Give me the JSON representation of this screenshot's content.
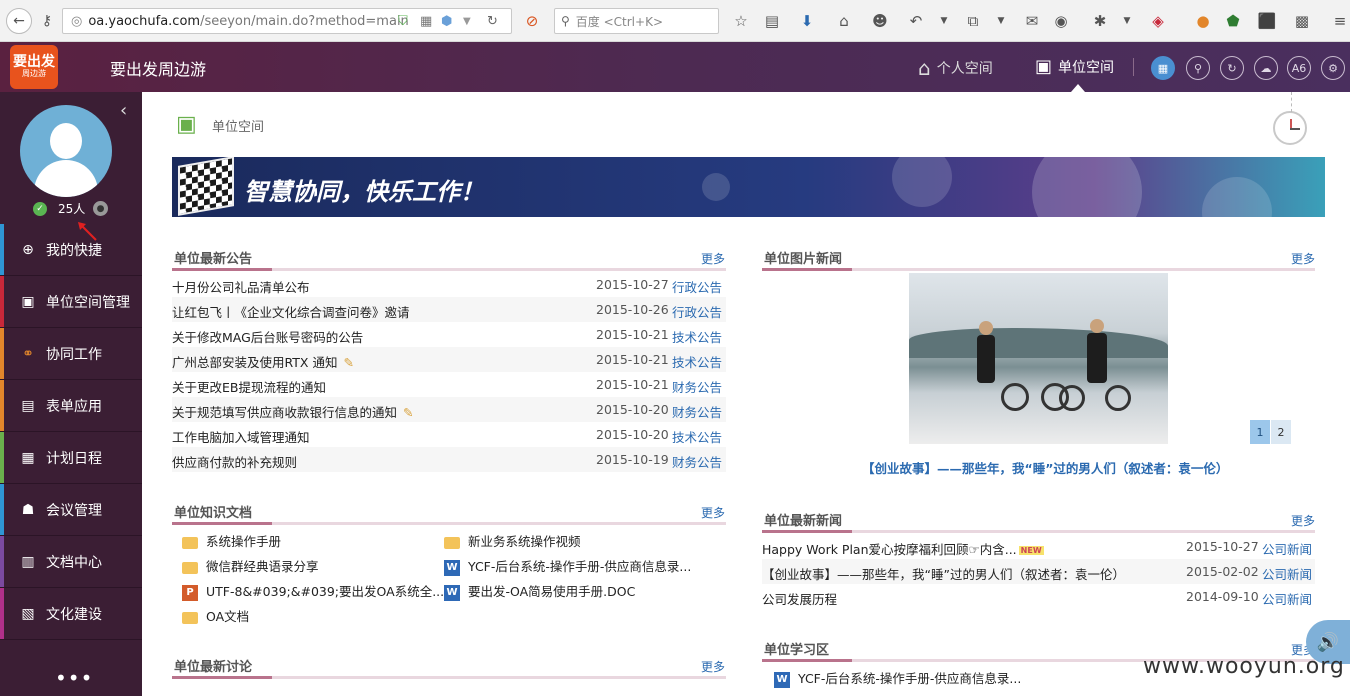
{
  "browser": {
    "url_domain": "oa.yaochufa.com",
    "url_path": "/seeyon/main.do?method=main",
    "search_placeholder": "百度 <Ctrl+K>"
  },
  "header": {
    "logo_main": "要出发",
    "logo_sub": "周边游",
    "app_title": "要出发周边游",
    "tabs": [
      {
        "label": "个人空间",
        "icon": "home-icon"
      },
      {
        "label": "单位空间",
        "icon": "building-icon"
      }
    ],
    "tool_icons": [
      "grid-icon",
      "search-icon",
      "refresh-icon",
      "cloud-icon",
      "a6-icon",
      "settings-icon"
    ],
    "a6_label": "A6"
  },
  "sidebar": {
    "online_count": "25人",
    "menu": [
      {
        "label": "我的快捷",
        "icon": "plus-circle-icon",
        "color": "#2f96d4"
      },
      {
        "label": "单位空间管理",
        "icon": "building-icon",
        "color": "#c8283a"
      },
      {
        "label": "协同工作",
        "icon": "share-icon",
        "color": "#e2862b"
      },
      {
        "label": "表单应用",
        "icon": "form-icon",
        "color": "#e2862b"
      },
      {
        "label": "计划日程",
        "icon": "calendar-icon",
        "color": "#6ab04c"
      },
      {
        "label": "会议管理",
        "icon": "meeting-icon",
        "color": "#2f96d4"
      },
      {
        "label": "文档中心",
        "icon": "document-icon",
        "color": "#7b4aa0"
      },
      {
        "label": "文化建设",
        "icon": "culture-icon",
        "color": "#b0308a"
      }
    ],
    "more": "•••"
  },
  "main": {
    "breadcrumb": "单位空间",
    "banner_text": "智慧协同，快乐工作！",
    "more_label": "更多",
    "announcements": {
      "title": "单位最新公告",
      "items": [
        {
          "title": "十月份公司礼品清单公布",
          "date": "2015-10-27",
          "category": "行政公告",
          "attach": false
        },
        {
          "title": "让红包飞丨《企业文化综合调查问卷》邀请",
          "date": "2015-10-26",
          "category": "行政公告",
          "attach": false
        },
        {
          "title": "关于修改MAG后台账号密码的公告",
          "date": "2015-10-21",
          "category": "技术公告",
          "attach": false
        },
        {
          "title": "广州总部安装及使用RTX 通知",
          "date": "2015-10-21",
          "category": "技术公告",
          "attach": true
        },
        {
          "title": "关于更改EB提现流程的通知",
          "date": "2015-10-21",
          "category": "财务公告",
          "attach": false
        },
        {
          "title": "关于规范填写供应商收款银行信息的通知",
          "date": "2015-10-20",
          "category": "财务公告",
          "attach": true
        },
        {
          "title": "工作电脑加入域管理通知",
          "date": "2015-10-20",
          "category": "技术公告",
          "attach": false
        },
        {
          "title": "供应商付款的补充规则",
          "date": "2015-10-19",
          "category": "财务公告",
          "attach": false
        }
      ]
    },
    "knowledge": {
      "title": "单位知识文档",
      "items": [
        {
          "name": "系统操作手册",
          "type": "folder"
        },
        {
          "name": "新业务系统操作视频",
          "type": "folder"
        },
        {
          "name": "微信群经典语录分享",
          "type": "folder"
        },
        {
          "name": "YCF-后台系统-操作手册-供应商信息录...",
          "type": "word"
        },
        {
          "name": "UTF-8&#039;&#039;要出发OA系统全...",
          "type": "ppt"
        },
        {
          "name": "要出发-OA简易使用手册.DOC",
          "type": "word"
        },
        {
          "name": "OA文档",
          "type": "folder"
        }
      ]
    },
    "discussion": {
      "title": "单位最新讨论"
    },
    "photo_news": {
      "title": "单位图片新闻",
      "caption": "【创业故事】——那些年，我“睡”过的男人们（叙述者：袁一伦）",
      "pages": [
        "1",
        "2"
      ]
    },
    "latest_news": {
      "title": "单位最新新闻",
      "items": [
        {
          "title": "Happy Work Plan爱心按摩福利回顾☞内含...",
          "new": true,
          "date": "2015-10-27",
          "category": "公司新闻"
        },
        {
          "title": "【创业故事】——那些年，我“睡”过的男人们（叙述者：袁一伦）",
          "new": false,
          "date": "2015-02-02",
          "category": "公司新闻"
        },
        {
          "title": "公司发展历程",
          "new": false,
          "date": "2014-09-10",
          "category": "公司新闻"
        }
      ],
      "new_tag": "NEW"
    },
    "study": {
      "title": "单位学习区",
      "items": [
        {
          "name": "YCF-后台系统-操作手册-供应商信息录...",
          "type": "word"
        }
      ]
    }
  },
  "watermark": "www.wooyun.org"
}
